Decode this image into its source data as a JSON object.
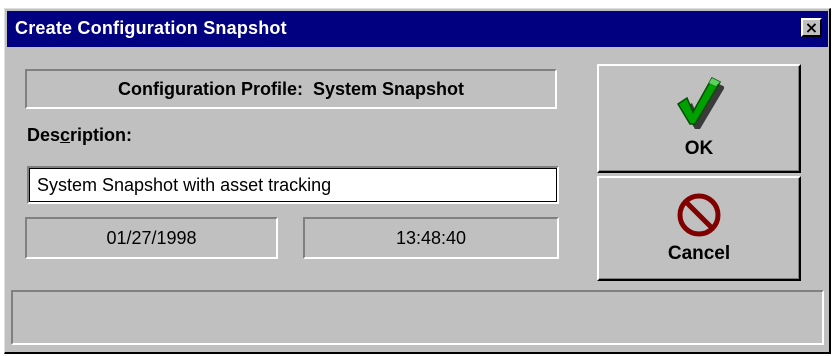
{
  "window": {
    "title": "Create Configuration Snapshot",
    "close_label": "×"
  },
  "profile": {
    "label": "Configuration Profile:  System Snapshot"
  },
  "description": {
    "label_pre": "Des",
    "label_hotkey": "c",
    "label_post": "ription:",
    "value": "System Snapshot with asset tracking"
  },
  "date": {
    "value": "01/27/1998"
  },
  "time": {
    "value": "13:48:40"
  },
  "buttons": {
    "ok_label": "OK",
    "cancel_label": "Cancel"
  },
  "colors": {
    "title_bar": "#000080",
    "face": "#c0c0c0",
    "check_green": "#00a000",
    "cancel_red": "#800000"
  },
  "icons": {
    "ok": "checkmark-icon",
    "cancel": "no-entry-icon"
  },
  "status_bar": {
    "text": ""
  }
}
